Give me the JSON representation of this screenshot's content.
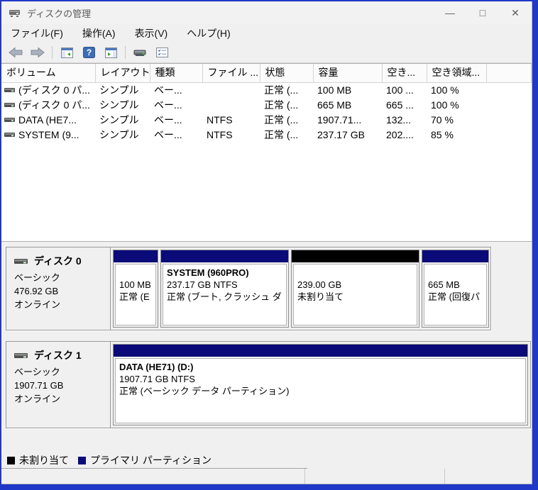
{
  "window": {
    "title": "ディスクの管理",
    "controls": {
      "minimize": "—",
      "maximize": "□",
      "close": "✕"
    }
  },
  "menu": {
    "items": [
      {
        "label": "ファイル(F)"
      },
      {
        "label": "操作(A)"
      },
      {
        "label": "表示(V)"
      },
      {
        "label": "ヘルプ(H)"
      }
    ]
  },
  "toolbar": {
    "icons": [
      "back",
      "forward",
      "show-console-tree",
      "help",
      "show-action-pane",
      "disk-properties",
      "list-options"
    ],
    "help_glyph": "?"
  },
  "volume_list": {
    "columns": [
      "ボリューム",
      "レイアウト",
      "種類",
      "ファイル ...",
      "状態",
      "容量",
      "空き...",
      "空き領域...",
      ""
    ],
    "rows": [
      {
        "cells": [
          "(ディスク 0 パ...",
          "シンプル",
          "ベー...",
          "",
          "正常 (...",
          "100 MB",
          "100 ...",
          "100 %"
        ]
      },
      {
        "cells": [
          "(ディスク 0 パ...",
          "シンプル",
          "ベー...",
          "",
          "正常 (...",
          "665 MB",
          "665 ...",
          "100 %"
        ]
      },
      {
        "cells": [
          "DATA (HE7...",
          "シンプル",
          "ベー...",
          "NTFS",
          "正常 (...",
          "1907.71...",
          "132...",
          "70 %"
        ]
      },
      {
        "cells": [
          "SYSTEM (9...",
          "シンプル",
          "ベー...",
          "NTFS",
          "正常 (...",
          "237.17 GB",
          "202....",
          "85 %"
        ]
      }
    ]
  },
  "disks": [
    {
      "name": "ディスク 0",
      "type": "ベーシック",
      "size": "476.92 GB",
      "status": "オンライン",
      "partitions": [
        {
          "label": "",
          "size_line": "100 MB",
          "status_line": "正常 (E",
          "head_color": "#0a0a78"
        },
        {
          "label": "SYSTEM (960PRO)",
          "size_line": "237.17 GB NTFS",
          "status_line": "正常 (ブート, クラッシュ ダ",
          "head_color": "#0a0a78"
        },
        {
          "label": "",
          "size_line": "239.00 GB",
          "status_line": "未割り当て",
          "head_color": "#000000"
        },
        {
          "label": "",
          "size_line": "665 MB",
          "status_line": "正常 (回復パ",
          "head_color": "#0a0a78"
        }
      ]
    },
    {
      "name": "ディスク 1",
      "type": "ベーシック",
      "size": "1907.71 GB",
      "status": "オンライン",
      "partitions": [
        {
          "label": "DATA (HE71) (D:)",
          "size_line": "1907.71 GB NTFS",
          "status_line": "正常 (ベーシック データ パーティション)",
          "head_color": "#0a0a78"
        }
      ]
    }
  ],
  "legend": {
    "items": [
      {
        "label": "未割り当て",
        "color": "#000000"
      },
      {
        "label": "プライマリ パーティション",
        "color": "#0a0a78"
      }
    ]
  },
  "colors": {
    "primary_partition": "#0a0a78",
    "unallocated": "#000000",
    "desktop": "#2038c8",
    "window_bg": "#f0f0f0"
  }
}
